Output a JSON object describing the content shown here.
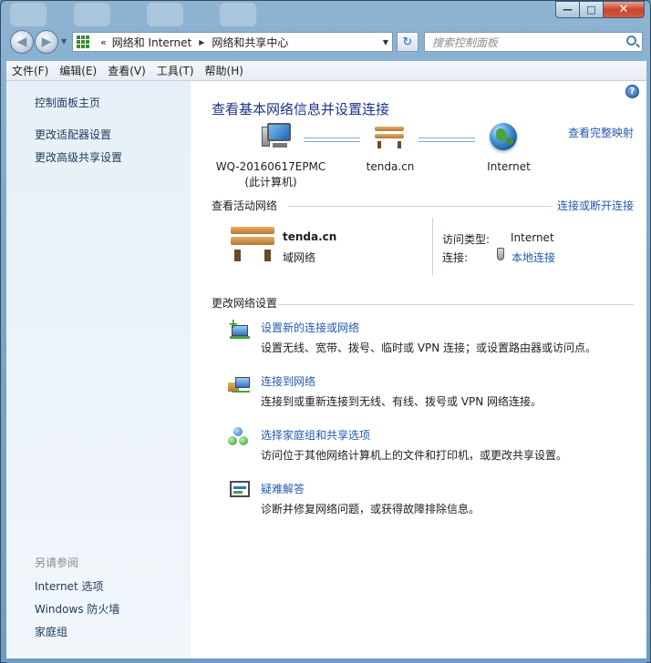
{
  "window": {
    "minimize_glyph": "—",
    "maximize_glyph": "□",
    "close_glyph": "✕"
  },
  "navigation": {
    "back_glyph": "◀",
    "forward_glyph": "▶",
    "address": {
      "prefix": "«",
      "crumbs": [
        "网络和 Internet",
        "网络和共享中心"
      ]
    },
    "refresh_glyph": "↻",
    "search_placeholder": "搜索控制面板"
  },
  "menu": {
    "items": [
      "文件(F)",
      "编辑(E)",
      "查看(V)",
      "工具(T)",
      "帮助(H)"
    ]
  },
  "sidebar": {
    "top_links": [
      "控制面板主页",
      "更改适配器设置",
      "更改高级共享设置"
    ],
    "see_also_title": "另请参阅",
    "see_also_links": [
      "Internet 选项",
      "Windows 防火墙",
      "家庭组"
    ]
  },
  "main": {
    "help_glyph": "?",
    "title": "查看基本网络信息并设置连接",
    "view_full_map": "查看完整映射",
    "map": {
      "computer_name": "WQ-20160617EPMC",
      "computer_sub": "(此计算机)",
      "network_name": "tenda.cn",
      "internet": "Internet"
    },
    "active_networks": {
      "heading": "查看活动网络",
      "connect_disconnect": "连接或断开连接",
      "network_name": "tenda.cn",
      "network_type": "域网络",
      "access_type_label": "访问类型:",
      "access_type_value": "Internet",
      "connections_label": "连接:",
      "connections_value": "本地连接"
    },
    "change_settings": {
      "heading": "更改网络设置",
      "tasks": [
        {
          "link": "设置新的连接或网络",
          "desc": "设置无线、宽带、拨号、临时或 VPN 连接；或设置路由器或访问点。",
          "icon": "new-connection-icon"
        },
        {
          "link": "连接到网络",
          "desc": "连接到或重新连接到无线、有线、拨号或 VPN 网络连接。",
          "icon": "connect-network-icon"
        },
        {
          "link": "选择家庭组和共享选项",
          "desc": "访问位于其他网络计算机上的文件和打印机，或更改共享设置。",
          "icon": "homegroup-icon"
        },
        {
          "link": "疑难解答",
          "desc": "诊断并修复网络问题，或获得故障排除信息。",
          "icon": "troubleshoot-icon"
        }
      ]
    }
  }
}
